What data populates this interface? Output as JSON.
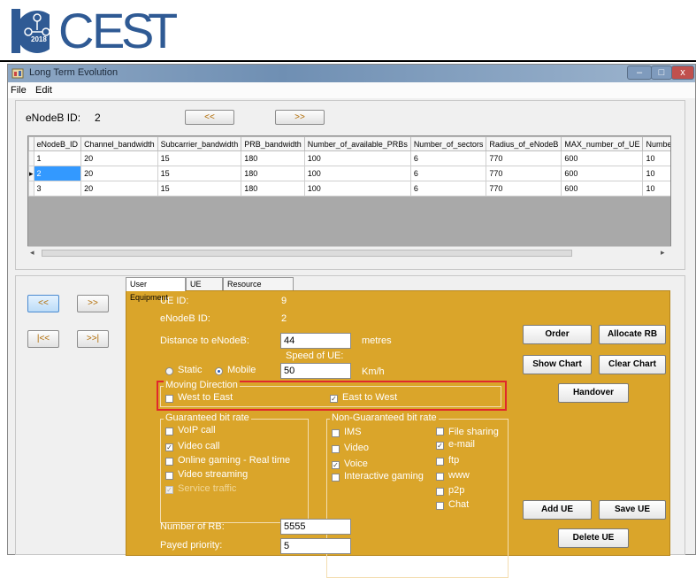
{
  "logo": {
    "letters": [
      "C",
      "E",
      "S",
      "T"
    ],
    "year": "2018"
  },
  "window": {
    "title": "Long Term Evolution",
    "controls": {
      "minimize": "–",
      "maximize": "□",
      "close": "x"
    }
  },
  "menu": [
    "File",
    "Edit"
  ],
  "enodeb_header": {
    "label": "eNodeB ID:",
    "value": "2",
    "prev_button": "<<",
    "next_button": ">>"
  },
  "grid": {
    "columns": [
      "eNodeB_ID",
      "Channel_bandwidth",
      "Subcarrier_bandwidth",
      "PRB_bandwidth",
      "Number_of_available_PRBs",
      "Number_of_sectors",
      "Radius_of_eNodeB",
      "MAX_number_of_UE",
      "Number"
    ],
    "rows": [
      [
        "1",
        "20",
        "15",
        "180",
        "100",
        "6",
        "770",
        "600",
        "10"
      ],
      [
        "2",
        "20",
        "15",
        "180",
        "100",
        "6",
        "770",
        "600",
        "10"
      ],
      [
        "3",
        "20",
        "15",
        "180",
        "100",
        "6",
        "770",
        "600",
        "10"
      ]
    ],
    "current_row_marker": "▸",
    "selected_row": 1
  },
  "ue_nav": {
    "prev": "<<",
    "next": ">>",
    "first": "|<<",
    "last": ">>|"
  },
  "tabs": [
    "User Equipment",
    "UE Data",
    "Resource Allocation"
  ],
  "ue_form": {
    "ue_id_label": "UE ID:",
    "ue_id_value": "9",
    "enodeb_id_label": "eNodeB ID:",
    "enodeb_id_value": "2",
    "distance_label": "Distance to eNodeB:",
    "distance_value": "44",
    "distance_unit": "metres",
    "speed_label": "Speed of UE:",
    "speed_value": "50",
    "speed_unit": "Km/h",
    "static_label": "Static",
    "mobile_label": "Mobile",
    "moving_direction_title": "Moving Direction",
    "west_to_east": "West to East",
    "east_to_west": "East to West",
    "gbr_title": "Guaranteed bit rate",
    "gbr_items": [
      {
        "label": "VoIP call",
        "checked": false
      },
      {
        "label": "Video call",
        "checked": true
      },
      {
        "label": "Online gaming - Real time",
        "checked": false
      },
      {
        "label": "Video streaming",
        "checked": false
      },
      {
        "label": "Service traffic",
        "checked": true
      }
    ],
    "ngbr_title": "Non-Guaranteed bit rate",
    "ngbr_left": [
      {
        "label": "IMS",
        "checked": false
      },
      {
        "label": "Video",
        "checked": false
      },
      {
        "label": "Voice",
        "checked": true
      },
      {
        "label": "Interactive gaming",
        "checked": false
      }
    ],
    "ngbr_right": [
      {
        "label": "File sharing",
        "checked": false
      },
      {
        "label": "e-mail",
        "checked": true
      },
      {
        "label": "ftp",
        "checked": false
      },
      {
        "label": "www",
        "checked": false
      },
      {
        "label": "p2p",
        "checked": false
      },
      {
        "label": "Chat",
        "checked": false
      }
    ],
    "num_rb_label": "Number of RB:",
    "num_rb_value": "5555",
    "payed_priority_label": "Payed priority:",
    "payed_priority_value": "5"
  },
  "actions": {
    "order": "Order",
    "allocate_rb": "Allocate RB",
    "show_chart": "Show Chart",
    "clear_chart": "Clear Chart",
    "handover": "Handover",
    "add_ue": "Add UE",
    "save_ue": "Save UE",
    "delete_ue": "Delete UE"
  },
  "colors": {
    "panel": "#daa52a",
    "highlight_box": "#e0282c",
    "logo": "#2f5a94",
    "selection": "#3399ff"
  }
}
